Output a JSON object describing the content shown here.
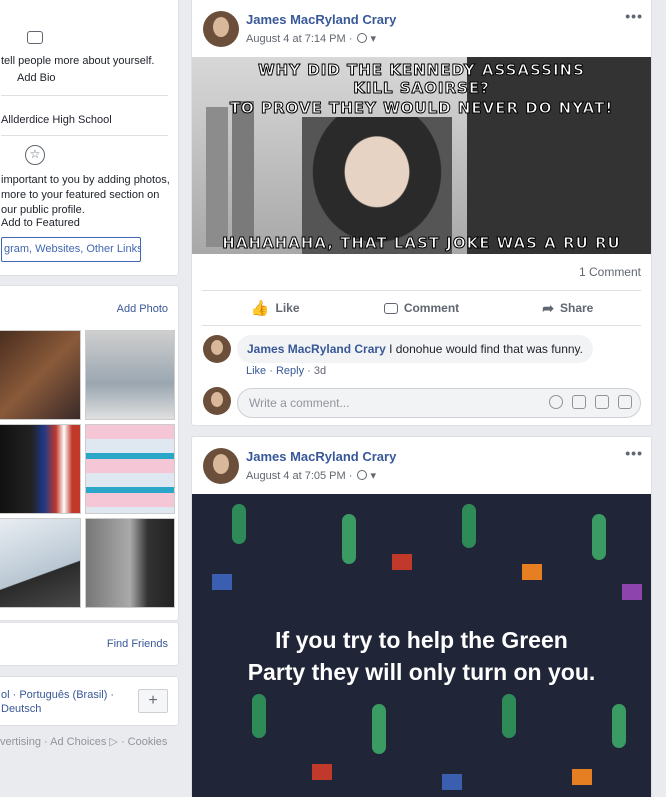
{
  "intro": {
    "bio_prompt": "tell people more about yourself.",
    "add_bio": "Add Bio",
    "school": "Allderdice High School",
    "featured_lines": [
      "important to you by adding photos,",
      "more to your featured section on",
      "our public profile."
    ],
    "add_featured": "Add to Featured",
    "links_button": "gram, Websites, Other Links"
  },
  "photos": {
    "add_photo": "Add Photo"
  },
  "friends": {
    "find_friends": "Find Friends"
  },
  "languages": {
    "line1": "ol · Português (Brasil) ·",
    "line2": "Deutsch",
    "add_label": "+"
  },
  "footer": {
    "text": "vertising · Ad Choices ▷ · Cookies"
  },
  "post1": {
    "author": "James MacRyland Crary",
    "timestamp": "August 4 at 7:14 PM ·",
    "meme": {
      "top_line1": "WHY DID THE KENNEDY ASSASSINS",
      "top_line2": "KILL SAOIRSE?",
      "top_line3": "TO PROVE THEY WOULD NEVER DO NYAT!",
      "bottom": "HAHAHAHA, THAT LAST JOKE WAS A RU RU"
    },
    "comment_count": "1 Comment",
    "actions": {
      "like": "Like",
      "comment": "Comment",
      "share": "Share"
    },
    "comment": {
      "author": "James MacRyland Crary",
      "text": "I donohue would find that was funny.",
      "like": "Like",
      "reply": "Reply",
      "age": "3d"
    },
    "input_placeholder": "Write a comment..."
  },
  "post2": {
    "author": "James MacRyland Crary",
    "timestamp": "August 4 at 7:05 PM ·",
    "text_line1": "If you try to help the Green",
    "text_line2": "Party they will only turn on you."
  },
  "colors": {
    "link": "#385898",
    "accent": "#4267b2",
    "cactus_bg": "#202638"
  }
}
